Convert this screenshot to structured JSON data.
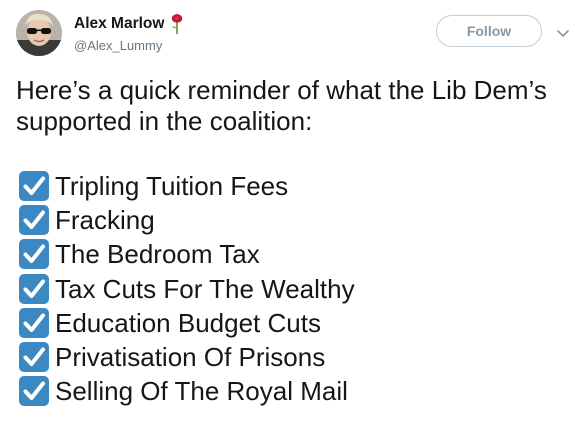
{
  "author": {
    "display_name": "Alex Marlow",
    "handle": "@Alex_Lummy",
    "name_emoji": "rose-icon"
  },
  "follow_button": {
    "label": "Follow"
  },
  "menu": {
    "icon": "chevron-down-icon"
  },
  "tweet": {
    "text": "Here’s a quick reminder of what the Lib Dem’s supported in the coalition:",
    "check_icon": "check-mark-button-icon",
    "items": [
      "Tripling Tuition Fees",
      "Fracking",
      "The Bedroom Tax",
      "Tax Cuts For The Wealthy",
      "Education Budget Cuts",
      "Privatisation Of Prisons",
      "Selling Of The Royal Mail"
    ]
  },
  "colors": {
    "text": "#14171a",
    "secondary": "#657786",
    "follow_border": "#c4ccd3",
    "follow_text": "#8899a6",
    "check_blue": "#3b88c3",
    "rose_red": "#be1931"
  }
}
